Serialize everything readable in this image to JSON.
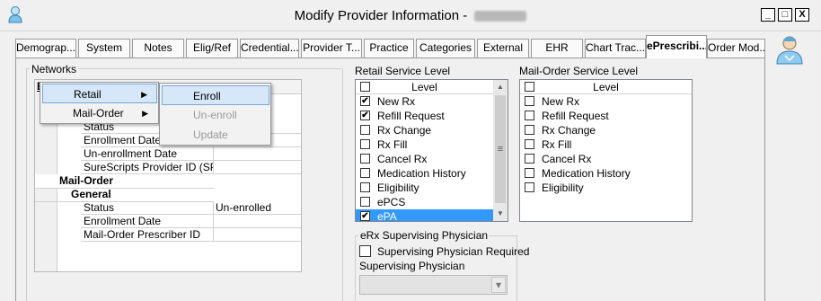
{
  "window": {
    "title": "Modify Provider Information - ",
    "controls": [
      "_",
      "□",
      "X"
    ]
  },
  "tabs": [
    "Demograp...",
    "System",
    "Notes",
    "Elig/Ref",
    "Credential...",
    "Provider T...",
    "Practice",
    "Categories",
    "External",
    "EHR",
    "Chart Trac...",
    "ePrescribi...",
    "Order Mod..."
  ],
  "networks": {
    "label": "Networks",
    "obscured_tail": "E",
    "rows": [
      {
        "key": "Status",
        "value": ""
      },
      {
        "key": "Enrollment Date",
        "value": ""
      },
      {
        "key": "Un-enrollment Date",
        "value": ""
      },
      {
        "key": "SureScripts Provider ID (SPI)",
        "value": ""
      },
      {
        "key": "Mail-Order",
        "value": ""
      },
      {
        "key": "General",
        "value": ""
      },
      {
        "key": "Status",
        "value": "Un-enrolled"
      },
      {
        "key": "Enrollment Date",
        "value": ""
      },
      {
        "key": "Mail-Order Prescriber ID",
        "value": ""
      }
    ]
  },
  "context_menu": {
    "items": [
      {
        "label": "Retail",
        "arrow": "▶"
      },
      {
        "label": "Mail-Order",
        "arrow": "▶"
      }
    ],
    "submenu": [
      {
        "label": "Enroll",
        "state": "highlighted"
      },
      {
        "label": "Un-enroll",
        "state": "disabled"
      },
      {
        "label": "Update",
        "state": "disabled"
      }
    ]
  },
  "retail": {
    "label": "Retail Service Level",
    "header": "Level",
    "items": [
      {
        "label": "New Rx",
        "checked": true,
        "mark": "✔"
      },
      {
        "label": "Refill Request",
        "checked": true,
        "mark": "✔"
      },
      {
        "label": "Rx Change",
        "checked": false,
        "mark": ""
      },
      {
        "label": "Rx Fill",
        "checked": false,
        "mark": ""
      },
      {
        "label": "Cancel Rx",
        "checked": false,
        "mark": ""
      },
      {
        "label": "Medication History",
        "checked": false,
        "mark": ""
      },
      {
        "label": "Eligibility",
        "checked": false,
        "mark": ""
      },
      {
        "label": "ePCS",
        "checked": false,
        "mark": ""
      },
      {
        "label": "ePA",
        "checked": true,
        "mark": "✔",
        "selected": true
      }
    ],
    "scroll": {
      "up": "▲",
      "grip": "≡",
      "down": "▼"
    }
  },
  "mailorder": {
    "label": "Mail-Order Service Level",
    "header": "Level",
    "items": [
      {
        "label": "New Rx",
        "mark": ""
      },
      {
        "label": "Refill Request",
        "mark": ""
      },
      {
        "label": "Rx Change",
        "mark": ""
      },
      {
        "label": "Rx Fill",
        "mark": ""
      },
      {
        "label": "Cancel Rx",
        "mark": ""
      },
      {
        "label": "Medication History",
        "mark": ""
      },
      {
        "label": "Eligibility",
        "mark": ""
      }
    ]
  },
  "supervising": {
    "group_label": "eRx Supervising Physician",
    "required_label": "Supervising Physician Required",
    "physician_label": "Supervising Physician",
    "dropdown_value": "",
    "dropdown_arrow": "▾"
  },
  "colors": {
    "selection": "#3399ff",
    "menu_highlight": "#d5e7f8"
  },
  "icons": {
    "app": "user-icon",
    "doctor": "doctor-avatar-icon"
  }
}
